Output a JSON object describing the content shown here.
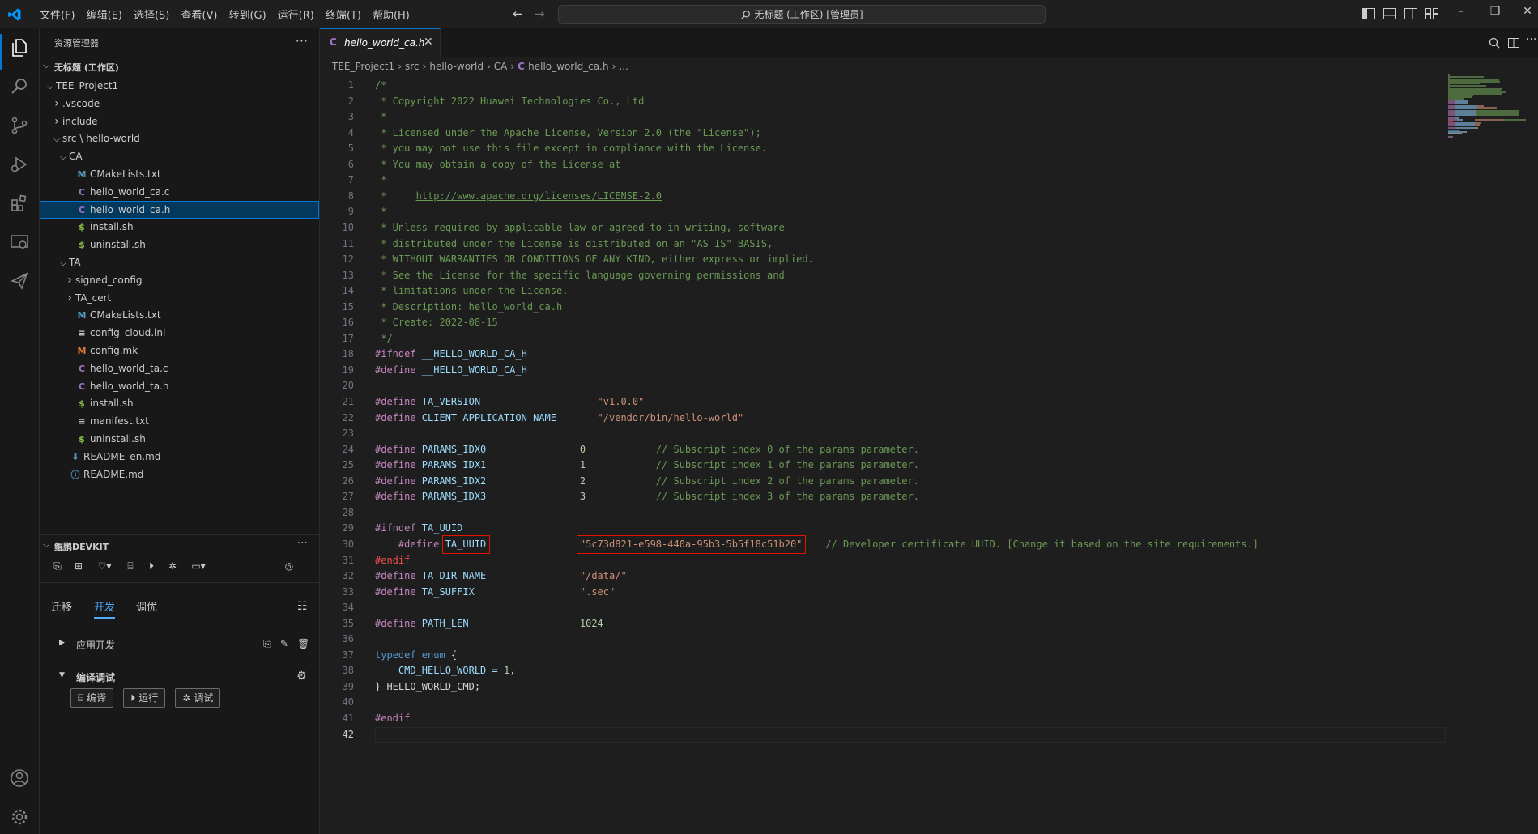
{
  "titlebar": {
    "menus": [
      "文件(F)",
      "编辑(E)",
      "选择(S)",
      "查看(V)",
      "转到(G)",
      "运行(R)",
      "终端(T)",
      "帮助(H)"
    ],
    "command_center": "无标题 (工作区) [管理员]"
  },
  "sidebar": {
    "title": "资源管理器",
    "workspace_label": "无标题 (工作区)",
    "tree": [
      {
        "label": "TEE_Project1",
        "depth": 1,
        "twisty": "open",
        "icon": "none"
      },
      {
        "label": ".vscode",
        "depth": 2,
        "twisty": "closed",
        "icon": "none"
      },
      {
        "label": "include",
        "depth": 2,
        "twisty": "closed",
        "icon": "none"
      },
      {
        "label": "src \\ hello-world",
        "depth": 2,
        "twisty": "open",
        "icon": "none"
      },
      {
        "label": "CA",
        "depth": 3,
        "twisty": "open",
        "icon": "none"
      },
      {
        "label": "CMakeLists.txt",
        "depth": 4,
        "twisty": "",
        "icon": "M",
        "icon_class": "fi-m"
      },
      {
        "label": "hello_world_ca.c",
        "depth": 4,
        "twisty": "",
        "icon": "C",
        "icon_class": "fi-c"
      },
      {
        "label": "hello_world_ca.h",
        "depth": 4,
        "twisty": "",
        "icon": "C",
        "icon_class": "fi-c",
        "selected": true
      },
      {
        "label": "install.sh",
        "depth": 4,
        "twisty": "",
        "icon": "$",
        "icon_class": "fi-sh"
      },
      {
        "label": "uninstall.sh",
        "depth": 4,
        "twisty": "",
        "icon": "$",
        "icon_class": "fi-sh"
      },
      {
        "label": "TA",
        "depth": 3,
        "twisty": "open",
        "icon": "none"
      },
      {
        "label": "signed_config",
        "depth": 4,
        "twisty": "closed",
        "icon": "none"
      },
      {
        "label": "TA_cert",
        "depth": 4,
        "twisty": "closed",
        "icon": "none"
      },
      {
        "label": "CMakeLists.txt",
        "depth": 4,
        "twisty": "",
        "icon": "M",
        "icon_class": "fi-m"
      },
      {
        "label": "config_cloud.ini",
        "depth": 4,
        "twisty": "",
        "icon": "≡",
        "icon_class": "fi-txt"
      },
      {
        "label": "config.mk",
        "depth": 4,
        "twisty": "",
        "icon": "M",
        "icon_class": "fi-mk"
      },
      {
        "label": "hello_world_ta.c",
        "depth": 4,
        "twisty": "",
        "icon": "C",
        "icon_class": "fi-c"
      },
      {
        "label": "hello_world_ta.h",
        "depth": 4,
        "twisty": "",
        "icon": "C",
        "icon_class": "fi-c"
      },
      {
        "label": "install.sh",
        "depth": 4,
        "twisty": "",
        "icon": "$",
        "icon_class": "fi-sh"
      },
      {
        "label": "manifest.txt",
        "depth": 4,
        "twisty": "",
        "icon": "≡",
        "icon_class": "fi-txt"
      },
      {
        "label": "uninstall.sh",
        "depth": 4,
        "twisty": "",
        "icon": "$",
        "icon_class": "fi-sh"
      },
      {
        "label": "README_en.md",
        "depth": 3,
        "twisty": "",
        "icon": "⬇",
        "icon_class": "fi-md"
      },
      {
        "label": "README.md",
        "depth": 3,
        "twisty": "",
        "icon": "ⓘ",
        "icon_class": "fi-info"
      }
    ],
    "devkit": {
      "title": "鲲鹏DEVKIT",
      "tabs": [
        "迁移",
        "开发",
        "调优"
      ],
      "active_tab": "开发",
      "sections": [
        {
          "label": "应用开发",
          "expanded": false
        },
        {
          "label": "编译调试",
          "expanded": true
        }
      ],
      "buttons": [
        "编译",
        "运行",
        "调试"
      ]
    }
  },
  "editor": {
    "tab_label": "hello_world_ca.h",
    "breadcrumb": [
      "TEE_Project1",
      "src",
      "hello-world",
      "CA",
      "hello_world_ca.h",
      "..."
    ],
    "lines": [
      [
        [
          "/*",
          "c-com"
        ]
      ],
      [
        [
          " * Copyright 2022 Huawei Technologies Co., Ltd",
          "c-com"
        ]
      ],
      [
        [
          " *",
          "c-com"
        ]
      ],
      [
        [
          " * Licensed under the Apache License, Version 2.0 (the \"License\");",
          "c-com"
        ]
      ],
      [
        [
          " * you may not use this file except in compliance with the License.",
          "c-com"
        ]
      ],
      [
        [
          " * You may obtain a copy of the License at",
          "c-com"
        ]
      ],
      [
        [
          " *",
          "c-com"
        ]
      ],
      [
        [
          " *     ",
          "c-com"
        ],
        [
          "http://www.apache.org/licenses/LICENSE-2.0",
          "c-link"
        ]
      ],
      [
        [
          " *",
          "c-com"
        ]
      ],
      [
        [
          " * Unless required by applicable law or agreed to in writing, software",
          "c-com"
        ]
      ],
      [
        [
          " * distributed under the License is distributed on an \"AS IS\" BASIS,",
          "c-com"
        ]
      ],
      [
        [
          " * WITHOUT WARRANTIES OR CONDITIONS OF ANY KIND, either express or implied.",
          "c-com"
        ]
      ],
      [
        [
          " * See the License for the specific language governing permissions and",
          "c-com"
        ]
      ],
      [
        [
          " * limitations under the License.",
          "c-com"
        ]
      ],
      [
        [
          " * Description: hello_world_ca.h",
          "c-com"
        ]
      ],
      [
        [
          " * Create: 2022-08-15",
          "c-com"
        ]
      ],
      [
        [
          " */",
          "c-com"
        ]
      ],
      [
        [
          "#ifndef ",
          "c-pp"
        ],
        [
          "__HELLO_WORLD_CA_H",
          "c-mac"
        ]
      ],
      [
        [
          "#define ",
          "c-pp"
        ],
        [
          "__HELLO_WORLD_CA_H",
          "c-mac"
        ]
      ],
      [],
      [
        [
          "#define ",
          "c-pp"
        ],
        [
          "TA_VERSION                    ",
          "c-mac"
        ],
        [
          "\"v1.0.0\"",
          "c-str"
        ]
      ],
      [
        [
          "#define ",
          "c-pp"
        ],
        [
          "CLIENT_APPLICATION_NAME       ",
          "c-mac"
        ],
        [
          "\"/vendor/bin/hello-world\"",
          "c-str"
        ]
      ],
      [],
      [
        [
          "#define ",
          "c-pp"
        ],
        [
          "PARAMS_IDX0                ",
          "c-mac"
        ],
        [
          "0",
          "c-num"
        ],
        [
          "            // Subscript index 0 of the params parameter.",
          "c-com"
        ]
      ],
      [
        [
          "#define ",
          "c-pp"
        ],
        [
          "PARAMS_IDX1                ",
          "c-mac"
        ],
        [
          "1",
          "c-num"
        ],
        [
          "            // Subscript index 1 of the params parameter.",
          "c-com"
        ]
      ],
      [
        [
          "#define ",
          "c-pp"
        ],
        [
          "PARAMS_IDX2                ",
          "c-mac"
        ],
        [
          "2",
          "c-num"
        ],
        [
          "            // Subscript index 2 of the params parameter.",
          "c-com"
        ]
      ],
      [
        [
          "#define ",
          "c-pp"
        ],
        [
          "PARAMS_IDX3                ",
          "c-mac"
        ],
        [
          "3",
          "c-num"
        ],
        [
          "            // Subscript index 3 of the params parameter.",
          "c-com"
        ]
      ],
      [],
      [
        [
          "#ifndef ",
          "c-pp"
        ],
        [
          "TA_UUID",
          "c-mac"
        ]
      ],
      [
        [
          "    #define ",
          "c-pp"
        ],
        [
          "TA_UUID",
          "c-mac"
        ],
        [
          "                ",
          "c-ink"
        ],
        [
          "\"5c73d821-e598-440a-95b3-5b5f18c51b20\"",
          "c-str"
        ],
        [
          "    // Developer certificate UUID. [Change it based on the site requirements.]",
          "c-com"
        ]
      ],
      [
        [
          "#endif",
          "c-red"
        ]
      ],
      [
        [
          "#define ",
          "c-pp"
        ],
        [
          "TA_DIR_NAME                ",
          "c-mac"
        ],
        [
          "\"/data/\"",
          "c-str"
        ]
      ],
      [
        [
          "#define ",
          "c-pp"
        ],
        [
          "TA_SUFFIX                  ",
          "c-mac"
        ],
        [
          "\".sec\"",
          "c-str"
        ]
      ],
      [],
      [
        [
          "#define ",
          "c-pp"
        ],
        [
          "PATH_LEN                   ",
          "c-mac"
        ],
        [
          "1024",
          "c-num"
        ]
      ],
      [],
      [
        [
          "typedef ",
          "c-kw"
        ],
        [
          "enum ",
          "c-kw"
        ],
        [
          "{",
          "c-ink"
        ]
      ],
      [
        [
          "    CMD_HELLO_WORLD = ",
          "c-mac"
        ],
        [
          "1",
          "c-num"
        ],
        [
          ",",
          "c-ink"
        ]
      ],
      [
        [
          "} HELLO_WORLD_CMD;",
          "c-ink"
        ]
      ],
      [],
      [
        [
          "#endif",
          "c-pp"
        ]
      ],
      []
    ],
    "current_line": 42
  },
  "colors": {
    "accent": "#0078d4",
    "highlight_box": "#e51400",
    "comment": "#6a9955",
    "string": "#ce9178"
  }
}
